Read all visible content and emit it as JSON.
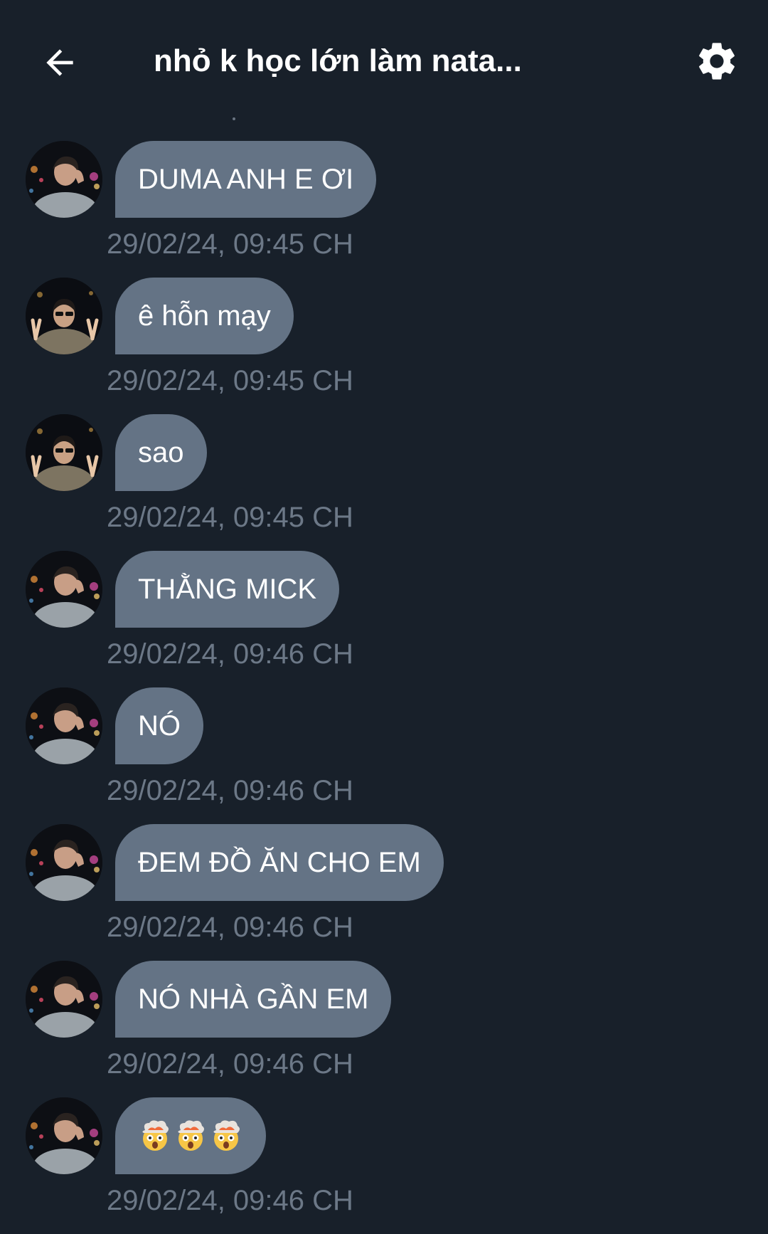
{
  "header": {
    "title": "nhỏ k học lớn làm nata..."
  },
  "icons": {
    "back": "arrow-left-icon",
    "settings": "gear-icon"
  },
  "colors": {
    "background": "#18202a",
    "bubble": "#647385",
    "timestamp": "#6c7887"
  },
  "messages": [
    {
      "text": "DUMA ANH E ƠI",
      "time": "29/02/24, 09:45 CH",
      "avatar": "avatar-a"
    },
    {
      "text": "ê hỗn mạy",
      "time": "29/02/24, 09:45 CH",
      "avatar": "avatar-b"
    },
    {
      "text": "sao",
      "time": "29/02/24, 09:45 CH",
      "avatar": "avatar-b"
    },
    {
      "text": "THẰNG MICK",
      "time": "29/02/24, 09:46 CH",
      "avatar": "avatar-a"
    },
    {
      "text": "NÓ",
      "time": "29/02/24, 09:46 CH",
      "avatar": "avatar-a"
    },
    {
      "text": "ĐEM ĐỒ ĂN CHO EM",
      "time": "29/02/24, 09:46 CH",
      "avatar": "avatar-a"
    },
    {
      "text": "NÓ NHÀ GẦN EM",
      "time": "29/02/24, 09:46 CH",
      "avatar": "avatar-a"
    },
    {
      "text": "🤯🤯🤯",
      "time": "29/02/24, 09:46 CH",
      "avatar": "avatar-a"
    }
  ]
}
